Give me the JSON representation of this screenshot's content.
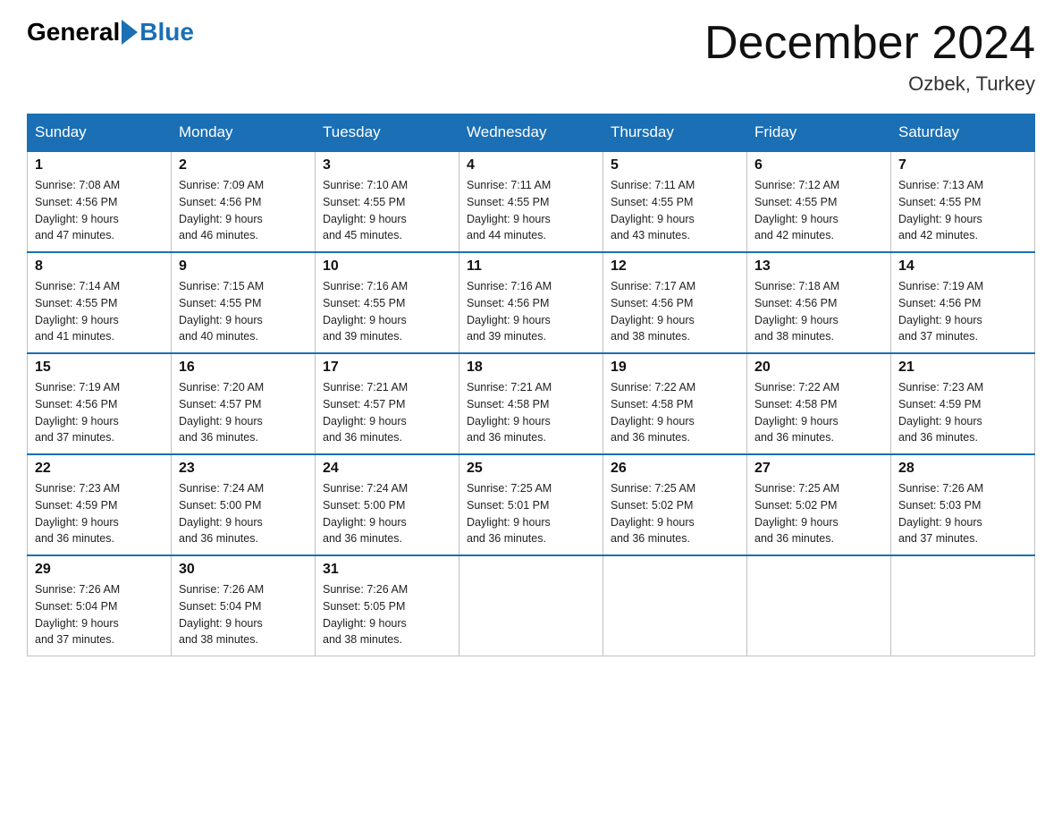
{
  "header": {
    "logo_general": "General",
    "logo_blue": "Blue",
    "month_title": "December 2024",
    "location": "Ozbek, Turkey"
  },
  "weekdays": [
    "Sunday",
    "Monday",
    "Tuesday",
    "Wednesday",
    "Thursday",
    "Friday",
    "Saturday"
  ],
  "weeks": [
    [
      {
        "day": 1,
        "sunrise": "7:08 AM",
        "sunset": "4:56 PM",
        "daylight": "9 hours and 47 minutes."
      },
      {
        "day": 2,
        "sunrise": "7:09 AM",
        "sunset": "4:56 PM",
        "daylight": "9 hours and 46 minutes."
      },
      {
        "day": 3,
        "sunrise": "7:10 AM",
        "sunset": "4:55 PM",
        "daylight": "9 hours and 45 minutes."
      },
      {
        "day": 4,
        "sunrise": "7:11 AM",
        "sunset": "4:55 PM",
        "daylight": "9 hours and 44 minutes."
      },
      {
        "day": 5,
        "sunrise": "7:11 AM",
        "sunset": "4:55 PM",
        "daylight": "9 hours and 43 minutes."
      },
      {
        "day": 6,
        "sunrise": "7:12 AM",
        "sunset": "4:55 PM",
        "daylight": "9 hours and 42 minutes."
      },
      {
        "day": 7,
        "sunrise": "7:13 AM",
        "sunset": "4:55 PM",
        "daylight": "9 hours and 42 minutes."
      }
    ],
    [
      {
        "day": 8,
        "sunrise": "7:14 AM",
        "sunset": "4:55 PM",
        "daylight": "9 hours and 41 minutes."
      },
      {
        "day": 9,
        "sunrise": "7:15 AM",
        "sunset": "4:55 PM",
        "daylight": "9 hours and 40 minutes."
      },
      {
        "day": 10,
        "sunrise": "7:16 AM",
        "sunset": "4:55 PM",
        "daylight": "9 hours and 39 minutes."
      },
      {
        "day": 11,
        "sunrise": "7:16 AM",
        "sunset": "4:56 PM",
        "daylight": "9 hours and 39 minutes."
      },
      {
        "day": 12,
        "sunrise": "7:17 AM",
        "sunset": "4:56 PM",
        "daylight": "9 hours and 38 minutes."
      },
      {
        "day": 13,
        "sunrise": "7:18 AM",
        "sunset": "4:56 PM",
        "daylight": "9 hours and 38 minutes."
      },
      {
        "day": 14,
        "sunrise": "7:19 AM",
        "sunset": "4:56 PM",
        "daylight": "9 hours and 37 minutes."
      }
    ],
    [
      {
        "day": 15,
        "sunrise": "7:19 AM",
        "sunset": "4:56 PM",
        "daylight": "9 hours and 37 minutes."
      },
      {
        "day": 16,
        "sunrise": "7:20 AM",
        "sunset": "4:57 PM",
        "daylight": "9 hours and 36 minutes."
      },
      {
        "day": 17,
        "sunrise": "7:21 AM",
        "sunset": "4:57 PM",
        "daylight": "9 hours and 36 minutes."
      },
      {
        "day": 18,
        "sunrise": "7:21 AM",
        "sunset": "4:58 PM",
        "daylight": "9 hours and 36 minutes."
      },
      {
        "day": 19,
        "sunrise": "7:22 AM",
        "sunset": "4:58 PM",
        "daylight": "9 hours and 36 minutes."
      },
      {
        "day": 20,
        "sunrise": "7:22 AM",
        "sunset": "4:58 PM",
        "daylight": "9 hours and 36 minutes."
      },
      {
        "day": 21,
        "sunrise": "7:23 AM",
        "sunset": "4:59 PM",
        "daylight": "9 hours and 36 minutes."
      }
    ],
    [
      {
        "day": 22,
        "sunrise": "7:23 AM",
        "sunset": "4:59 PM",
        "daylight": "9 hours and 36 minutes."
      },
      {
        "day": 23,
        "sunrise": "7:24 AM",
        "sunset": "5:00 PM",
        "daylight": "9 hours and 36 minutes."
      },
      {
        "day": 24,
        "sunrise": "7:24 AM",
        "sunset": "5:00 PM",
        "daylight": "9 hours and 36 minutes."
      },
      {
        "day": 25,
        "sunrise": "7:25 AM",
        "sunset": "5:01 PM",
        "daylight": "9 hours and 36 minutes."
      },
      {
        "day": 26,
        "sunrise": "7:25 AM",
        "sunset": "5:02 PM",
        "daylight": "9 hours and 36 minutes."
      },
      {
        "day": 27,
        "sunrise": "7:25 AM",
        "sunset": "5:02 PM",
        "daylight": "9 hours and 36 minutes."
      },
      {
        "day": 28,
        "sunrise": "7:26 AM",
        "sunset": "5:03 PM",
        "daylight": "9 hours and 37 minutes."
      }
    ],
    [
      {
        "day": 29,
        "sunrise": "7:26 AM",
        "sunset": "5:04 PM",
        "daylight": "9 hours and 37 minutes."
      },
      {
        "day": 30,
        "sunrise": "7:26 AM",
        "sunset": "5:04 PM",
        "daylight": "9 hours and 38 minutes."
      },
      {
        "day": 31,
        "sunrise": "7:26 AM",
        "sunset": "5:05 PM",
        "daylight": "9 hours and 38 minutes."
      },
      null,
      null,
      null,
      null
    ]
  ],
  "labels": {
    "sunrise": "Sunrise: ",
    "sunset": "Sunset: ",
    "daylight": "Daylight: "
  }
}
